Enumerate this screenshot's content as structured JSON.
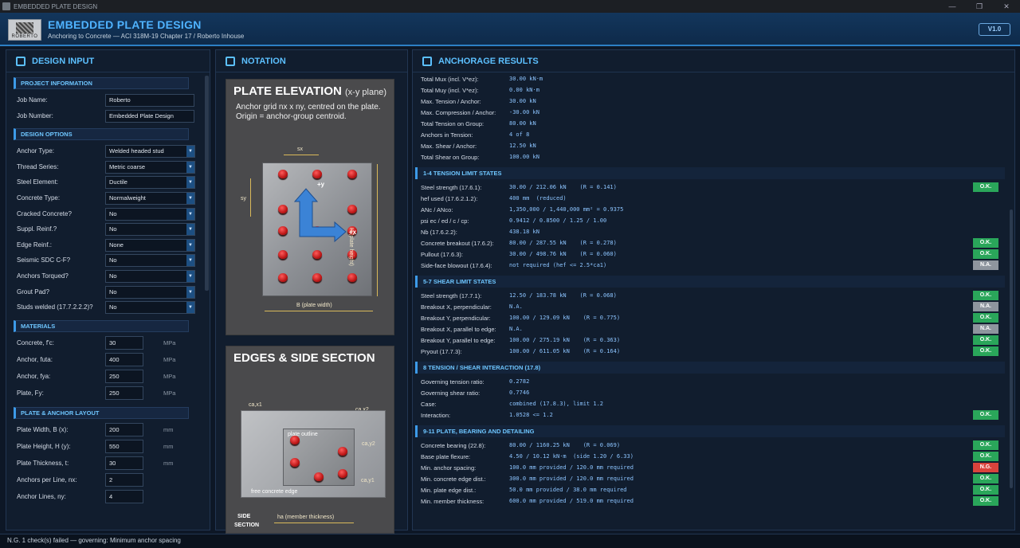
{
  "window": {
    "title": "EMBEDDED PLATE DESIGN"
  },
  "header": {
    "logo_text": "ROBERTO",
    "title": "EMBEDDED PLATE DESIGN",
    "subtitle": "Anchoring to Concrete — ACI 318M-19 Chapter 17  /  Roberto Inhouse",
    "version": "V1.0"
  },
  "input": {
    "heading": "DESIGN INPUT",
    "project": {
      "title": "PROJECT INFORMATION",
      "job_name_label": "Job Name:",
      "job_name": "Roberto",
      "job_number_label": "Job Number:",
      "job_number": "Embedded Plate Design"
    },
    "options": {
      "title": "DESIGN OPTIONS",
      "items": [
        {
          "label": "Anchor Type:",
          "value": "Welded headed stud"
        },
        {
          "label": "Thread Series:",
          "value": "Metric coarse"
        },
        {
          "label": "Steel Element:",
          "value": "Ductile"
        },
        {
          "label": "Concrete Type:",
          "value": "Normalweight"
        },
        {
          "label": "Cracked Concrete?",
          "value": "No"
        },
        {
          "label": "Suppl. Reinf.?",
          "value": "No"
        },
        {
          "label": "Edge Reinf.:",
          "value": "None"
        },
        {
          "label": "Seismic SDC C-F?",
          "value": "No"
        },
        {
          "label": "Anchors Torqued?",
          "value": "No"
        },
        {
          "label": "Grout Pad?",
          "value": "No"
        },
        {
          "label": "Studs welded (17.7.2.2.2)?",
          "value": "No"
        }
      ]
    },
    "materials": {
      "title": "MATERIALS",
      "items": [
        {
          "label": "Concrete, f'c:",
          "value": "30",
          "unit": "MPa"
        },
        {
          "label": "Anchor, futa:",
          "value": "400",
          "unit": "MPa"
        },
        {
          "label": "Anchor, fya:",
          "value": "250",
          "unit": "MPa"
        },
        {
          "label": "Plate, Fy:",
          "value": "250",
          "unit": "MPa"
        }
      ]
    },
    "layout": {
      "title": "PLATE & ANCHOR LAYOUT",
      "items": [
        {
          "label": "Plate Width, B (x):",
          "value": "200",
          "unit": "mm"
        },
        {
          "label": "Plate Height, H (y):",
          "value": "550",
          "unit": "mm"
        },
        {
          "label": "Plate Thickness, t:",
          "value": "30",
          "unit": "mm"
        },
        {
          "label": "Anchors per Line, nx:",
          "value": "2",
          "unit": ""
        },
        {
          "label": "Anchor Lines, ny:",
          "value": "4",
          "unit": ""
        }
      ]
    }
  },
  "notation": {
    "heading": "NOTATION",
    "elevation": {
      "title": "PLATE ELEVATION",
      "title_small": "(x-y plane)",
      "desc": "Anchor grid nx x ny, centred on the plate. Origin = anchor-group centroid.",
      "sx": "sx",
      "sy": "sy",
      "plus_y": "+y",
      "plus_x": "+x",
      "h_label": "H (plate height)",
      "b_label": "B (plate width)"
    },
    "edges": {
      "title": "EDGES & SIDE SECTION",
      "cax1": "ca,x1",
      "cax2": "ca,x2",
      "cay2": "ca,y2",
      "cay1": "ca,y1",
      "plate_outline": "plate outline",
      "free_edge": "free concrete edge",
      "side": "SIDE",
      "section": "SECTION",
      "ha": "ha (member thickness)"
    }
  },
  "results": {
    "heading": "ANCHORAGE RESULTS",
    "summary": [
      {
        "label": "Total Mux (incl. V*ez):",
        "value": "30.00 kN·m"
      },
      {
        "label": "Total Muy (incl. V*ez):",
        "value": "0.00 kN·m"
      },
      {
        "label": "Max. Tension / Anchor:",
        "value": "30.00 kN"
      },
      {
        "label": "Max. Compression / Anchor:",
        "value": "-30.00 kN"
      },
      {
        "label": "Total Tension on Group:",
        "value": "80.00 kN"
      },
      {
        "label": "Anchors in Tension:",
        "value": "4 of 8"
      },
      {
        "label": "Max. Shear / Anchor:",
        "value": "12.50 kN"
      },
      {
        "label": "Total Shear on Group:",
        "value": "100.00 kN"
      }
    ],
    "tension": {
      "title": "1-4  TENSION LIMIT STATES",
      "rows": [
        {
          "label": "Steel strength (17.6.1):",
          "value": "30.00 / 212.06 kN    (R = 0.141)",
          "badge": "O.K.",
          "status": "ok"
        },
        {
          "label": "hef used (17.6.2.1.2):",
          "value": "400 mm  (reduced)",
          "badge": "",
          "status": ""
        },
        {
          "label": "ANc / ANco:",
          "value": "1,350,000 / 1,440,000 mm² = 0.9375",
          "badge": "",
          "status": ""
        },
        {
          "label": "psi ec / ed / c / cp:",
          "value": "0.9412 / 0.8500 / 1.25 / 1.00",
          "badge": "",
          "status": ""
        },
        {
          "label": "Nb (17.6.2.2):",
          "value": "438.18 kN",
          "badge": "",
          "status": ""
        },
        {
          "label": "Concrete breakout (17.6.2):",
          "value": "80.00 / 287.55 kN    (R = 0.278)",
          "badge": "O.K.",
          "status": "ok"
        },
        {
          "label": "Pullout (17.6.3):",
          "value": "30.00 / 498.76 kN    (R = 0.060)",
          "badge": "O.K.",
          "status": "ok"
        },
        {
          "label": "Side-face blowout (17.6.4):",
          "value": "not required (hef <= 2.5*ca1)",
          "badge": "N.A.",
          "status": "na"
        }
      ]
    },
    "shear": {
      "title": "5-7  SHEAR LIMIT STATES",
      "rows": [
        {
          "label": "Steel strength (17.7.1):",
          "value": "12.50 / 183.78 kN    (R = 0.068)",
          "badge": "O.K.",
          "status": "ok"
        },
        {
          "label": "Breakout X, perpendicular:",
          "value": "N.A.",
          "badge": "N.A.",
          "status": "na"
        },
        {
          "label": "Breakout Y, perpendicular:",
          "value": "100.00 / 129.09 kN    (R = 0.775)",
          "badge": "O.K.",
          "status": "ok"
        },
        {
          "label": "Breakout X, parallel to edge:",
          "value": "N.A.",
          "badge": "N.A.",
          "status": "na"
        },
        {
          "label": "Breakout Y, parallel to edge:",
          "value": "100.00 / 275.19 kN    (R = 0.363)",
          "badge": "O.K.",
          "status": "ok"
        },
        {
          "label": "Pryout (17.7.3):",
          "value": "100.00 / 611.05 kN    (R = 0.164)",
          "badge": "O.K.",
          "status": "ok"
        }
      ]
    },
    "interaction": {
      "title": "8  TENSION / SHEAR INTERACTION (17.8)",
      "rows": [
        {
          "label": "Governing tension ratio:",
          "value": "0.2782",
          "badge": "",
          "status": ""
        },
        {
          "label": "Governing shear ratio:",
          "value": "0.7746",
          "badge": "",
          "status": ""
        },
        {
          "label": "Case:",
          "value": "combined (17.8.3), limit 1.2",
          "badge": "",
          "status": ""
        },
        {
          "label": "Interaction:",
          "value": "1.0528 <= 1.2",
          "badge": "O.K.",
          "status": "ok"
        }
      ]
    },
    "detailing": {
      "title": "9-11  PLATE, BEARING AND DETAILING",
      "rows": [
        {
          "label": "Concrete bearing (22.8):",
          "value": "80.00 / 1160.25 kN    (R = 0.069)",
          "badge": "O.K.",
          "status": "ok"
        },
        {
          "label": "Base plate flexure:",
          "value": "4.50 / 10.12 kN·m  (side 1.20 / 6.33)",
          "badge": "O.K.",
          "status": "ok"
        },
        {
          "label": "Min. anchor spacing:",
          "value": "100.0 mm provided / 120.0 mm required",
          "badge": "N.G.",
          "status": "ng"
        },
        {
          "label": "Min. concrete edge dist.:",
          "value": "300.0 mm provided / 120.0 mm required",
          "badge": "O.K.",
          "status": "ok"
        },
        {
          "label": "Min. plate edge dist.:",
          "value": "50.0 mm provided / 38.0 mm required",
          "badge": "O.K.",
          "status": "ok"
        },
        {
          "label": "Min. member thickness:",
          "value": "600.0 mm provided / 519.0 mm required",
          "badge": "O.K.",
          "status": "ok"
        }
      ]
    }
  },
  "status": {
    "text": "N.G.  1 check(s) failed — governing: Minimum anchor spacing"
  }
}
